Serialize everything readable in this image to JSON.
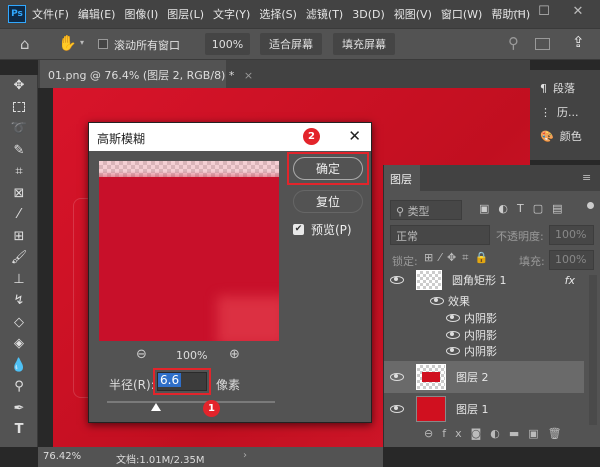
{
  "app": {
    "logo": "Ps",
    "window_controls": [
      "—",
      "☐",
      "✕"
    ]
  },
  "menu": [
    "文件(F)",
    "编辑(E)",
    "图像(I)",
    "图层(L)",
    "文字(Y)",
    "选择(S)",
    "滤镜(T)",
    "3D(D)",
    "视图(V)",
    "窗口(W)",
    "帮助(H)"
  ],
  "options": {
    "scroll_all": "滚动所有窗口",
    "zoom": "100%",
    "fit_screen": "适合屏幕",
    "fill_screen": "填充屏幕"
  },
  "doc_tab": {
    "title": "01.png @ 76.4% (图层 2, RGB/8) *",
    "close": "×"
  },
  "right_panels": [
    {
      "icon": "paragraph-icon",
      "label": "段落"
    },
    {
      "icon": "history-icon",
      "label": "历..."
    },
    {
      "icon": "palette-icon",
      "label": "颜色"
    }
  ],
  "layers_panel": {
    "tab": "图层",
    "filter_placeholder": "类型",
    "blend_mode": "正常",
    "opacity_label": "不透明度:",
    "opacity": "100%",
    "lock_label": "锁定:",
    "fill_label": "填充:",
    "fill": "100%",
    "layers": [
      {
        "name": "圆角矩形 1",
        "fx": "fx",
        "effects_label": "效果",
        "effects": [
          "内阴影",
          "内阴影",
          "内阴影"
        ]
      },
      {
        "name": "图层 2",
        "selected": true
      },
      {
        "name": "图层 1"
      }
    ]
  },
  "status": {
    "zoom": "76.42%",
    "doc": "文档:1.01M/2.35M"
  },
  "dialog": {
    "title": "高斯模糊",
    "ok": "确定",
    "reset": "复位",
    "preview_label": "预览(P)",
    "preview_checked": true,
    "zoom": "100%",
    "radius_label": "半径(R):",
    "radius": "6.6",
    "unit": "像素",
    "badge1": "1",
    "badge2": "2",
    "accent": "#e3242b"
  }
}
